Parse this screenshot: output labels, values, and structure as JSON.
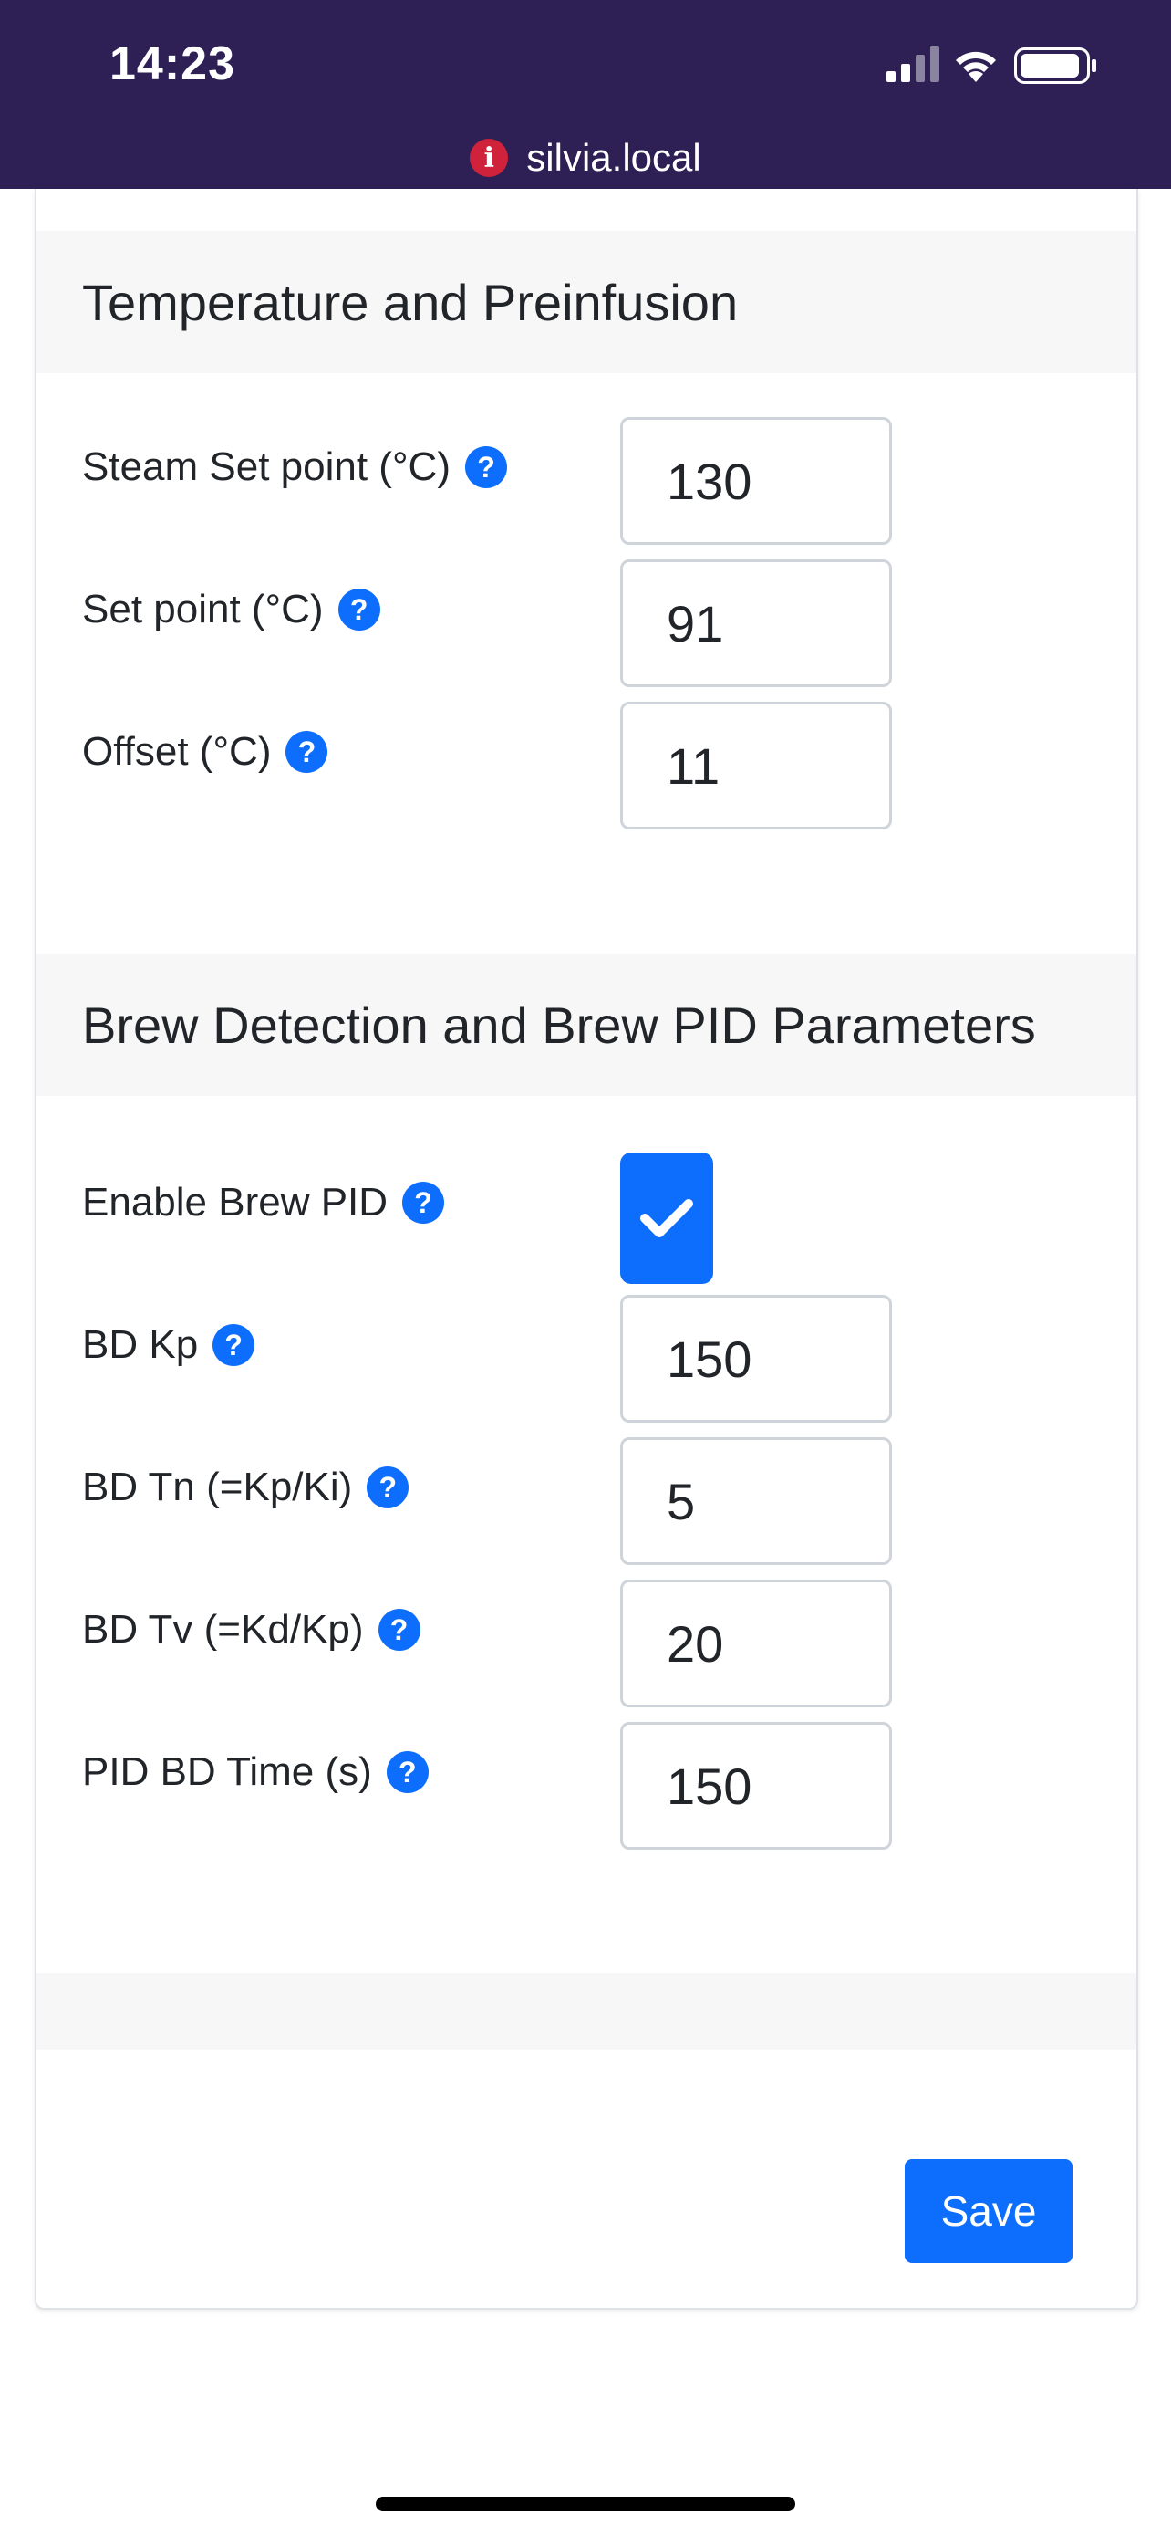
{
  "status_bar": {
    "time": "14:23"
  },
  "url_bar": {
    "warning_icon": "i",
    "url": "silvia.local"
  },
  "sections": {
    "temperature": {
      "title": "Temperature and Preinfusion",
      "fields": [
        {
          "label": "Steam Set point (°C)",
          "value": "130"
        },
        {
          "label": "Set point (°C)",
          "value": "91"
        },
        {
          "label": "Offset (°C)",
          "value": "11"
        }
      ]
    },
    "brew": {
      "title": "Brew Detection and Brew PID Parameters",
      "enable_label": "Enable Brew PID",
      "enable_checked": true,
      "fields": [
        {
          "label": "BD Kp",
          "value": "150"
        },
        {
          "label": "BD Tn (=Kp/Ki)",
          "value": "5"
        },
        {
          "label": "BD Tv (=Kd/Kp)",
          "value": "20"
        },
        {
          "label": "PID BD Time (s)",
          "value": "150"
        }
      ]
    }
  },
  "help_icon": "?",
  "save_label": "Save",
  "colors": {
    "topbar": "#2e2055",
    "accent": "#0d6efd",
    "warning": "#d0223a"
  }
}
